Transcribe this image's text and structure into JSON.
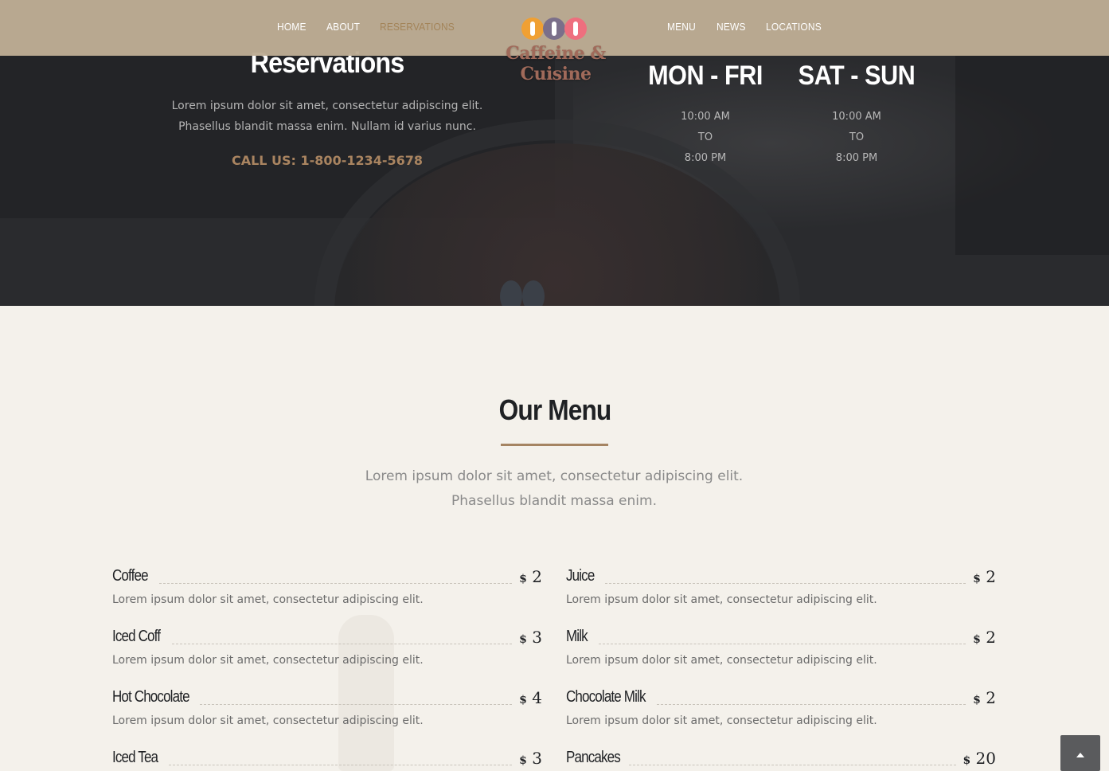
{
  "nav": {
    "left_links": [
      "HOME",
      "ABOUT",
      "RESERVATIONS"
    ],
    "right_links": [
      "MENU",
      "NEWS",
      "LOCATIONS"
    ],
    "active": "RESERVATIONS",
    "brand": "Caffeine & Cuisine",
    "logo_icon": "coffee-beans-logo-icon"
  },
  "reservations": {
    "title": "Reservations",
    "text": "Lorem ipsum dolor sit amet, consectetur adipiscing elit. Phasellus blandit massa enim. Nullam id varius nunc.",
    "phone": "CALL US: 1-800-1234-5678"
  },
  "hours": [
    {
      "days": "MON - FRI",
      "open": "10:00 AM",
      "to": "TO",
      "close": "8:00 PM"
    },
    {
      "days": "SAT - SUN",
      "open": "10:00 AM",
      "to": "TO",
      "close": "8:00 PM"
    }
  ],
  "menu": {
    "title": "Our Menu",
    "subtitle_line1": "Lorem ipsum dolor sit amet, consectetur adipiscing elit.",
    "subtitle_line2": "Phasellus blandit massa enim.",
    "items_left": [
      {
        "name": "Coffee",
        "currency": "$",
        "price": "2",
        "desc": "Lorem ipsum dolor sit amet, consectetur adipiscing elit."
      },
      {
        "name": "Iced Coff",
        "currency": "$",
        "price": "3",
        "desc": "Lorem ipsum dolor sit amet, consectetur adipiscing elit."
      },
      {
        "name": "Hot Chocolate",
        "currency": "$",
        "price": "4",
        "desc": "Lorem ipsum dolor sit amet, consectetur adipiscing elit."
      },
      {
        "name": "Iced Tea",
        "currency": "$",
        "price": "3",
        "desc": ""
      }
    ],
    "items_right": [
      {
        "name": "Juice",
        "currency": "$",
        "price": "2",
        "desc": "Lorem ipsum dolor sit amet, consectetur adipiscing elit."
      },
      {
        "name": "Milk",
        "currency": "$",
        "price": "2",
        "desc": "Lorem ipsum dolor sit amet, consectetur adipiscing elit."
      },
      {
        "name": "Chocolate Milk",
        "currency": "$",
        "price": "2",
        "desc": "Lorem ipsum dolor sit amet, consectetur adipiscing elit."
      },
      {
        "name": "Pancakes",
        "currency": "$",
        "price": "20",
        "desc": ""
      }
    ]
  },
  "scroll_top_icon": "chevron-up-icon",
  "colors": {
    "accent": "#a98460",
    "nav_bg": "#bdac94",
    "hero_bg": "#2a2b2e",
    "page_bg": "#f4f1eb",
    "logo_bean_colors": [
      "#f0a033",
      "#7b6f8a",
      "#ee6f7e"
    ]
  }
}
